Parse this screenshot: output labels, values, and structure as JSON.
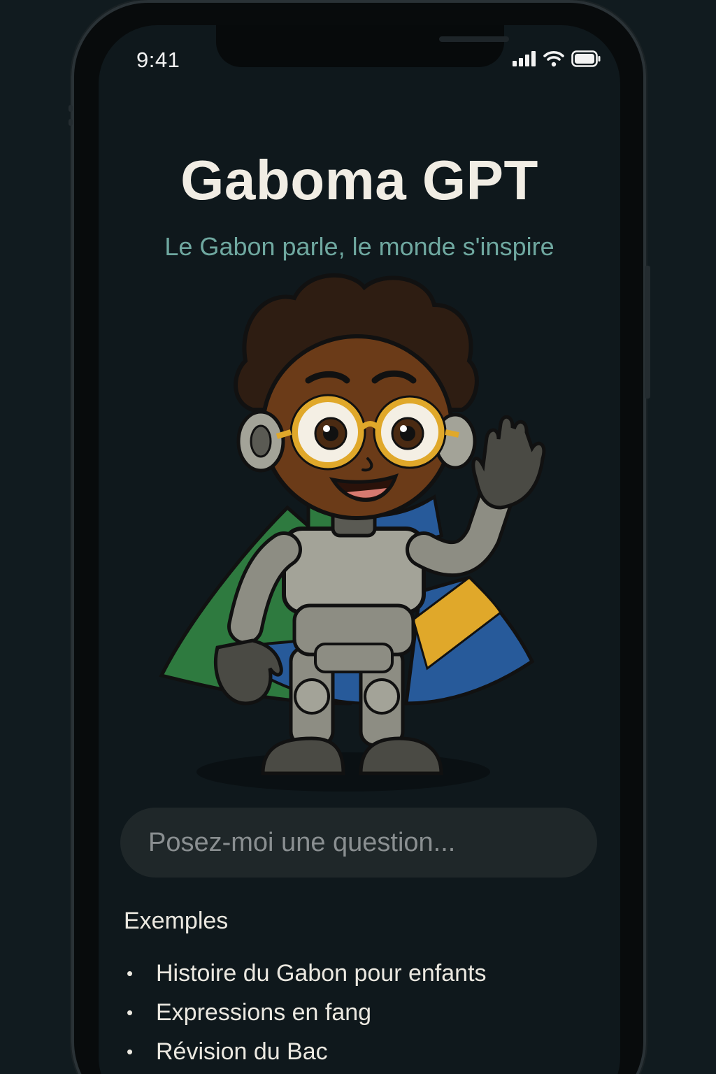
{
  "status_bar": {
    "time": "9:41",
    "icons": [
      "signal-icon",
      "wifi-icon",
      "battery-icon"
    ]
  },
  "app": {
    "title": "Gaboma GPT",
    "subtitle": "Le Gabon parle, le monde s'inspire"
  },
  "mascot": {
    "icon": "robot-mascot-illustration",
    "flag_colors": [
      "#2e7a3f",
      "#e0a82a",
      "#275a9a"
    ]
  },
  "input": {
    "placeholder": "Posez-moi une question..."
  },
  "examples": {
    "heading": "Exemples",
    "items": [
      "Histoire du Gabon pour enfants",
      "Expressions en fang",
      "Révision du Bac"
    ]
  },
  "colors": {
    "background": "#0f181c",
    "title": "#f1ede4",
    "subtitle": "#6fa8a0",
    "input_bg": "#1f2729"
  }
}
